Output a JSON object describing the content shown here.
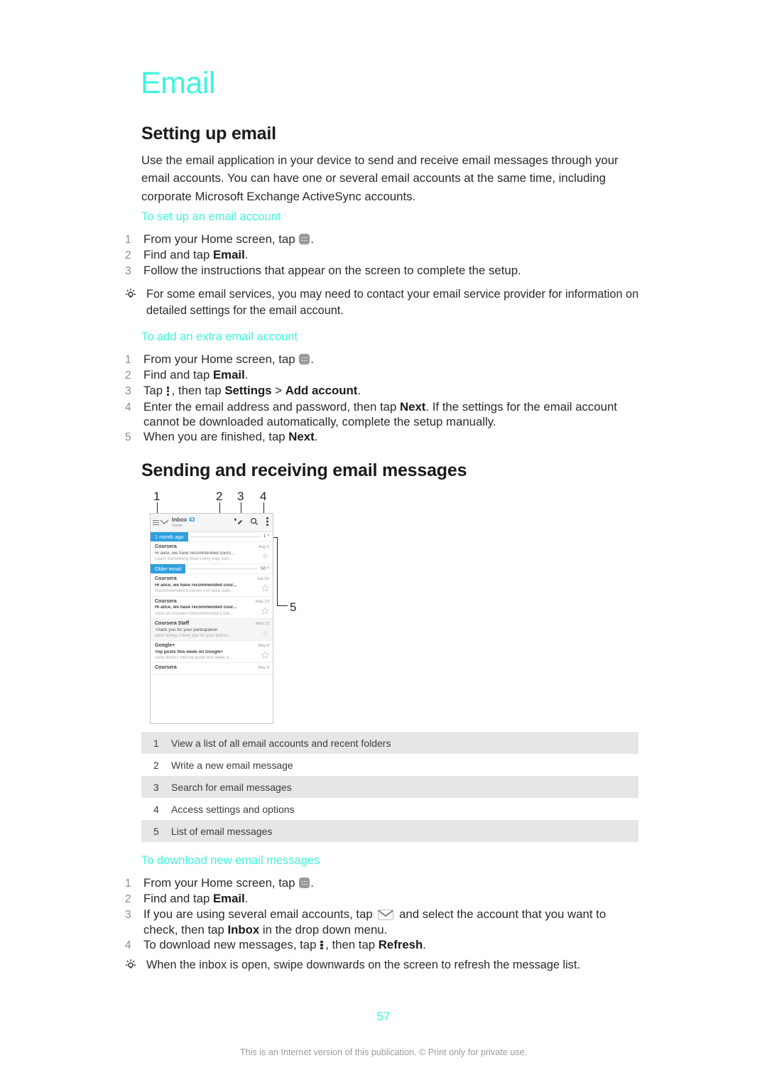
{
  "chapter": {
    "title": "Email"
  },
  "section_setting": {
    "heading": "Setting up email",
    "intro": "Use the email application in your device to send and receive email messages through your email accounts. You can have one or several email accounts at the same time, including corporate Microsoft Exchange ActiveSync accounts.",
    "sub_setup": "To set up an email account",
    "sub_extra": "To add an extra email account",
    "steps_setup": [
      {
        "num": "1",
        "pre": "From your Home screen, tap ",
        "icon": "app-drawer-icon",
        "post": "."
      },
      {
        "num": "2",
        "pre": "Find and tap ",
        "bold": "Email",
        "post": "."
      },
      {
        "num": "3",
        "pre": "Follow the instructions that appear on the screen to complete the setup.",
        "post": ""
      }
    ],
    "tip": "For some email services, you may need to contact your email service provider for information on detailed settings for the email account.",
    "steps_extra": [
      {
        "num": "1",
        "pre": "From your Home screen, tap ",
        "icon": "app-drawer-icon",
        "post": "."
      },
      {
        "num": "2",
        "pre": "Find and tap ",
        "bold": "Email",
        "post": "."
      },
      {
        "num": "3",
        "pre": "Tap ",
        "icon": "overflow-menu-icon",
        "mid": ", then tap ",
        "bold": "Settings",
        "sep": " > ",
        "bold2": "Add account",
        "post": "."
      },
      {
        "num": "4",
        "pre": "Enter the email address and password, then tap ",
        "bold": "Next",
        "post": ". If the settings for the email account cannot be downloaded automatically, complete the setup manually."
      },
      {
        "num": "5",
        "pre": "When you are finished, tap ",
        "bold": "Next",
        "post": "."
      }
    ]
  },
  "section_sending": {
    "heading": "Sending and receiving email messages",
    "callout_labels": [
      "1",
      "2",
      "3",
      "4",
      "5"
    ],
    "legend": [
      {
        "num": "1",
        "text": "View a list of all email accounts and recent folders"
      },
      {
        "num": "2",
        "text": "Write a new email message"
      },
      {
        "num": "3",
        "text": "Search for email messages"
      },
      {
        "num": "4",
        "text": "Access settings and options"
      },
      {
        "num": "5",
        "text": "List of email messages"
      }
    ]
  },
  "screenshot": {
    "toolbar": {
      "menu_icon": "hamburger-icon",
      "chevron_icon": "chevron-down-icon",
      "title": "Inbox",
      "count": "43",
      "account": "Gmail",
      "compose_icon": "compose-icon",
      "search_icon": "search-icon",
      "overflow_icon": "overflow-menu-icon"
    },
    "groups": [
      {
        "label": "1 month ago",
        "count": "1"
      },
      {
        "label": "Older email",
        "count": "50"
      }
    ],
    "messages": [
      {
        "from": "Coursera",
        "date": "Aug 9",
        "subject": "Hi alice, we have recommended cours...",
        "preview": "Learn Something New Every Day Join...",
        "bold_subject": false,
        "starred": true,
        "shaded": false
      },
      {
        "from": "Coursera",
        "date": "Jun 29",
        "subject": "Hi alice, we have recommended cour...",
        "preview": "Recommended Courses For alice Join...",
        "bold_subject": true,
        "starred": false,
        "shaded": false
      },
      {
        "from": "Coursera",
        "date": "May 23",
        "subject": "Hi alice, we have recommended cour...",
        "preview": "View all courses! Recommended Cour...",
        "bold_subject": true,
        "starred": false,
        "shaded": false
      },
      {
        "from": "Coursera Staff",
        "date": "May 12",
        "subject": "Thank you for your participation",
        "preview": "alice honey,Thank you for your partici...",
        "bold_subject": false,
        "starred": true,
        "shaded": true
      },
      {
        "from": "Google+",
        "date": "May 8",
        "subject": "Top posts this week on Google+",
        "preview": "View What's HotTop posts this week o...",
        "bold_subject": true,
        "starred": false,
        "shaded": false
      },
      {
        "from": "Coursera",
        "date": "May 6",
        "subject": "",
        "preview": "",
        "bold_subject": false,
        "starred": false,
        "shaded": false
      }
    ]
  },
  "section_download": {
    "heading": "To download new email messages",
    "steps": [
      {
        "num": "1",
        "pre": "From your Home screen, tap ",
        "icon": "app-drawer-icon",
        "post": "."
      },
      {
        "num": "2",
        "pre": "Find and tap ",
        "bold": "Email",
        "post": "."
      },
      {
        "num": "3",
        "pre": "If you are using several email accounts, tap ",
        "icon": "envelope-icon",
        "mid": " and select the account that you want to check, then tap ",
        "bold": "Inbox",
        "post": " in the drop down menu."
      },
      {
        "num": "4",
        "pre": "To download new messages, tap ",
        "icon": "overflow-menu-icon",
        "mid": ", then tap ",
        "bold": "Refresh",
        "post": "."
      }
    ],
    "tip": "When the inbox is open, swipe downwards on the screen to refresh the message list."
  },
  "footer": {
    "page_number": "57",
    "note": "This is an Internet version of this publication. © Print only for private use."
  },
  "colors": {
    "accent": "#3ff5dc",
    "chip": "#2e9fe0",
    "legend_shade": "#e5e6e7"
  }
}
